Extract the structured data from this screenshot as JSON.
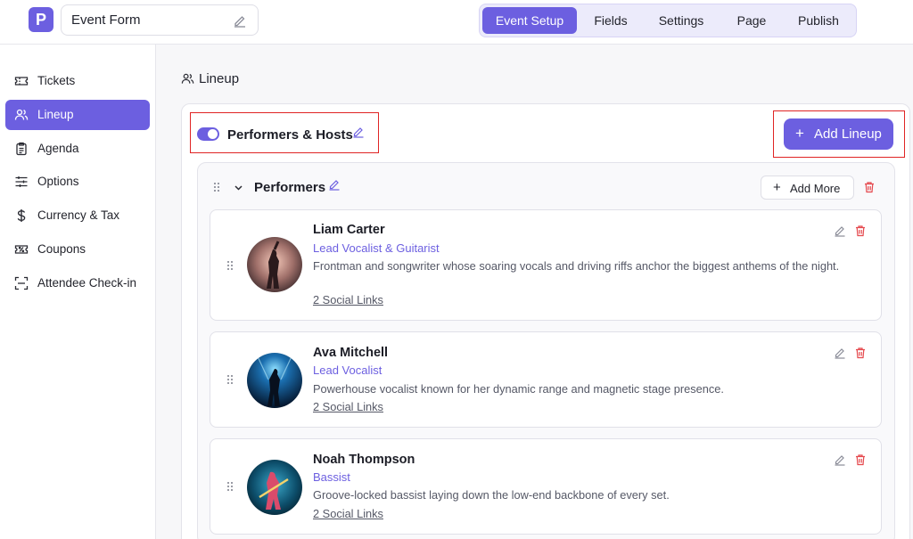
{
  "colors": {
    "accent": "#6c5fe0",
    "danger": "#e5484d",
    "highlight_box": "#e02424"
  },
  "header": {
    "logo_letter": "P",
    "form_name": "Event Form",
    "tabs": [
      {
        "label": "Event Setup",
        "active": true
      },
      {
        "label": "Fields"
      },
      {
        "label": "Settings"
      },
      {
        "label": "Page"
      },
      {
        "label": "Publish"
      }
    ]
  },
  "sidebar": {
    "items": [
      {
        "label": "Tickets",
        "icon": "ticket-icon"
      },
      {
        "label": "Lineup",
        "icon": "users-icon",
        "active": true
      },
      {
        "label": "Agenda",
        "icon": "clipboard-icon"
      },
      {
        "label": "Options",
        "icon": "sliders-icon"
      },
      {
        "label": "Currency & Tax",
        "icon": "dollar-icon"
      },
      {
        "label": "Coupons",
        "icon": "coupon-icon"
      },
      {
        "label": "Attendee Check-in",
        "icon": "scan-icon"
      }
    ]
  },
  "main": {
    "section_title": "Lineup",
    "lineup_toggle_on": true,
    "lineup_title": "Performers & Hosts",
    "add_lineup_label": "Add Lineup",
    "group": {
      "title": "Performers",
      "add_more_label": "Add More",
      "performers": [
        {
          "name": "Liam Carter",
          "role": "Lead Vocalist & Guitarist",
          "bio": "Frontman and songwriter whose soaring vocals and driving riffs anchor the biggest anthems of the night.",
          "links": "2 Social Links"
        },
        {
          "name": "Ava Mitchell",
          "role": "Lead Vocalist",
          "bio": "Powerhouse vocalist known for her dynamic range and magnetic stage presence.",
          "links": "2 Social Links"
        },
        {
          "name": "Noah Thompson",
          "role": "Bassist",
          "bio": "Groove-locked bassist laying down the low-end backbone of every set.",
          "links": "2 Social Links"
        }
      ]
    }
  }
}
